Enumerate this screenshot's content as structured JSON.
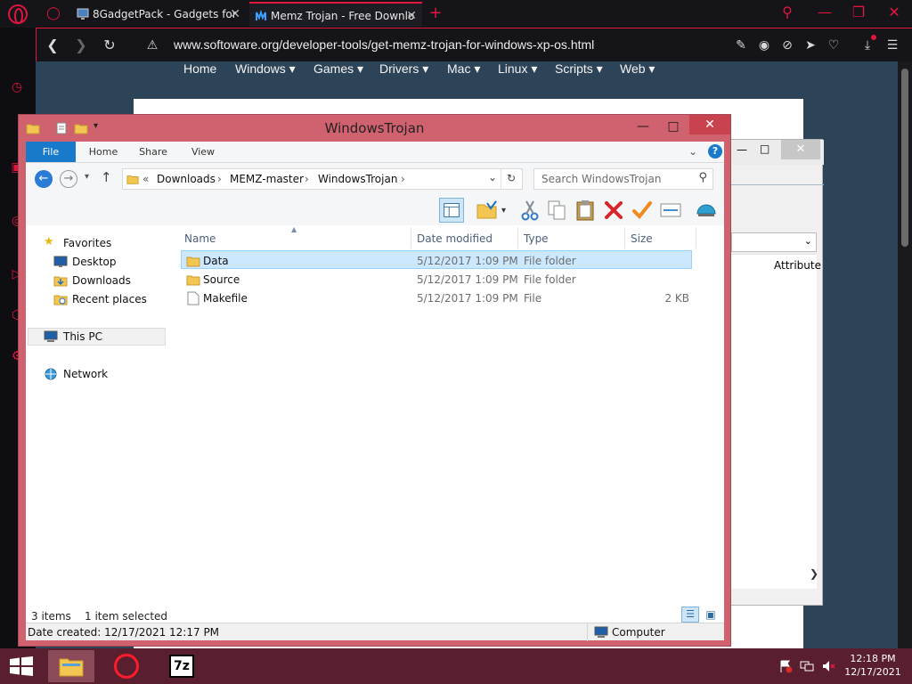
{
  "browser": {
    "tabs": [
      {
        "title": "8GadgetPack - Gadgets for"
      },
      {
        "title": "Memz Trojan - Free Downlo"
      }
    ],
    "url": "www.softoware.org/developer-tools/get-memz-trojan-for-windows-xp-os.html",
    "accent_color": "#e0163f"
  },
  "site_nav": [
    "Home",
    "Windows",
    "Games",
    "Drivers",
    "Mac",
    "Linux",
    "Scripts",
    "Web"
  ],
  "background_window": {
    "column": "Attribute"
  },
  "explorer": {
    "title": "WindowsTrojan",
    "ribbon_tabs": [
      "File",
      "Home",
      "Share",
      "View"
    ],
    "breadcrumb": [
      "Downloads",
      "MEMZ-master",
      "WindowsTrojan"
    ],
    "search_placeholder": "Search WindowsTrojan",
    "nav": {
      "favorites": "Favorites",
      "desktop": "Desktop",
      "downloads": "Downloads",
      "recent": "Recent places",
      "thispc": "This PC",
      "network": "Network"
    },
    "columns": {
      "name": "Name",
      "date": "Date modified",
      "type": "Type",
      "size": "Size"
    },
    "files": [
      {
        "name": "Data",
        "date": "5/12/2017 1:09 PM",
        "type": "File folder",
        "size": ""
      },
      {
        "name": "Source",
        "date": "5/12/2017 1:09 PM",
        "type": "File folder",
        "size": ""
      },
      {
        "name": "Makefile",
        "date": "5/12/2017 1:09 PM",
        "type": "File",
        "size": "2 KB"
      }
    ],
    "status": {
      "items": "3 items",
      "selected": "1 item selected"
    },
    "details": {
      "created": "Date created: 12/17/2021 12:17 PM",
      "location": "Computer"
    }
  },
  "taskbar": {
    "apps": [
      "File Explorer",
      "Opera",
      "7-Zip"
    ],
    "time": "12:18 PM",
    "date": "12/17/2021"
  }
}
